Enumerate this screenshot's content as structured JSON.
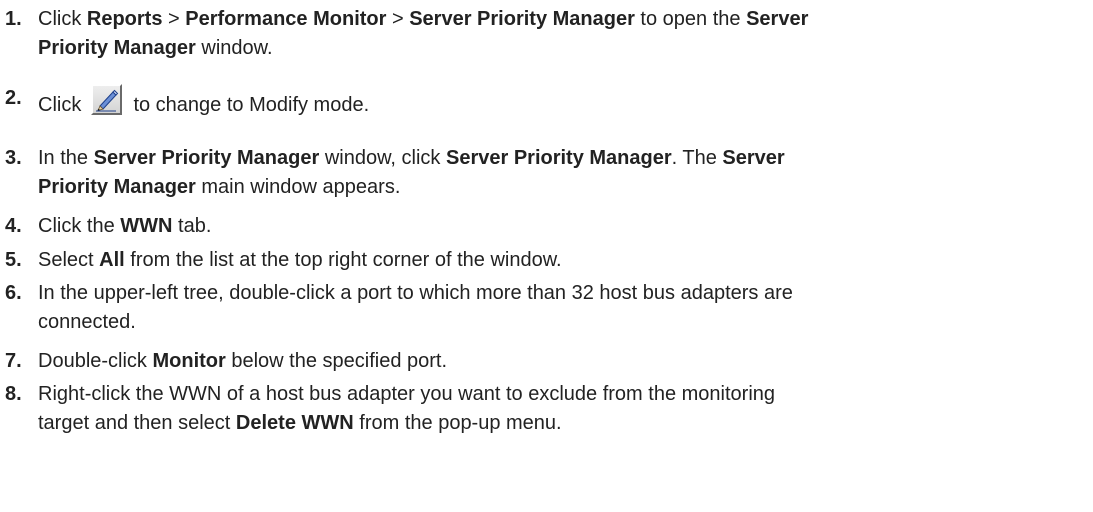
{
  "steps": [
    {
      "number": "1.",
      "segments": [
        {
          "text": "Click ",
          "bold": false
        },
        {
          "text": "Reports",
          "bold": true
        },
        {
          "text": " > ",
          "bold": false
        },
        {
          "text": "Performance Monitor",
          "bold": true
        },
        {
          "text": " > ",
          "bold": false
        },
        {
          "text": "Server Priority Manager",
          "bold": true
        },
        {
          "text": " to open the ",
          "bold": false
        },
        {
          "text": "Server",
          "bold": true
        },
        {
          "text": "\n",
          "bold": false
        },
        {
          "text": "Priority Manager",
          "bold": true
        },
        {
          "text": " window.",
          "bold": false
        }
      ]
    },
    {
      "number": "2.",
      "segments": [
        {
          "text": "Click ",
          "bold": false
        },
        {
          "icon": "modify-pen-icon"
        },
        {
          "text": " to change to Modify mode.",
          "bold": false
        }
      ]
    },
    {
      "number": "3.",
      "segments": [
        {
          "text": "In the ",
          "bold": false
        },
        {
          "text": "Server Priority Manager",
          "bold": true
        },
        {
          "text": " window, click ",
          "bold": false
        },
        {
          "text": "Server Priority Manager",
          "bold": true
        },
        {
          "text": ". The ",
          "bold": false
        },
        {
          "text": "Server",
          "bold": true
        },
        {
          "text": "\n",
          "bold": false
        },
        {
          "text": "Priority Manager",
          "bold": true
        },
        {
          "text": " main window appears.",
          "bold": false
        }
      ]
    },
    {
      "number": "4.",
      "segments": [
        {
          "text": "Click the ",
          "bold": false
        },
        {
          "text": "WWN",
          "bold": true
        },
        {
          "text": " tab.",
          "bold": false
        }
      ]
    },
    {
      "number": "5.",
      "segments": [
        {
          "text": "Select ",
          "bold": false
        },
        {
          "text": "All",
          "bold": true
        },
        {
          "text": " from the list at the top right corner of the window.",
          "bold": false
        }
      ]
    },
    {
      "number": "6.",
      "segments": [
        {
          "text": "In the upper-left tree, double-click a port to which more than 32 host bus adapters are",
          "bold": false
        },
        {
          "text": "\n",
          "bold": false
        },
        {
          "text": "connected.",
          "bold": false
        }
      ]
    },
    {
      "number": "7.",
      "segments": [
        {
          "text": "Double-click ",
          "bold": false
        },
        {
          "text": "Monitor",
          "bold": true
        },
        {
          "text": " below the specified port.",
          "bold": false
        }
      ]
    },
    {
      "number": "8.",
      "segments": [
        {
          "text": "Right-click the WWN of a host bus adapter you want to exclude from the monitoring",
          "bold": false
        },
        {
          "text": "\n",
          "bold": false
        },
        {
          "text": "target and then select ",
          "bold": false
        },
        {
          "text": "Delete WWN",
          "bold": true
        },
        {
          "text": " from the pop-up menu.",
          "bold": false
        }
      ]
    }
  ]
}
